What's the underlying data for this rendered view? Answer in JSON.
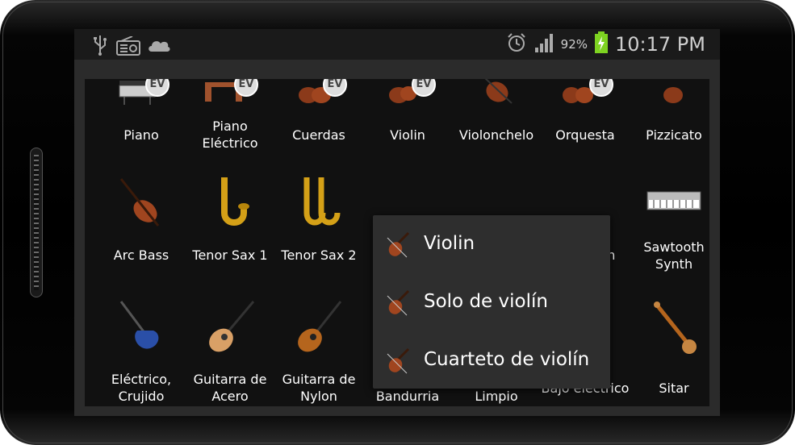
{
  "statusbar": {
    "left_icons": [
      "usb-icon",
      "radio-icon",
      "cloud-icon"
    ],
    "battery_percent": "92%",
    "time": "10:17 PM"
  },
  "instruments": {
    "row1": [
      "Piano",
      "Piano Eléctrico",
      "Cuerdas",
      "Violin",
      "Violonchelo",
      "Orquesta",
      "Pizzicato"
    ],
    "row2": [
      "Arc Bass",
      "Tenor Sax 1",
      "Tenor Sax 2",
      "",
      "",
      "th",
      "Sawtooth Synth"
    ],
    "row3": [
      "Eléctrico, Crujido",
      "Guitarra de Acero",
      "Guitarra de Nylon",
      "Mandolin, Bandurria",
      "Eléctrico, Limpio",
      "Bajo eléctrico",
      "Sitar"
    ]
  },
  "popup_menu": {
    "items": [
      "Violin",
      "Solo de violín",
      "Cuarteto de violín"
    ]
  },
  "ev_badge": "EV",
  "colors": {
    "screen_bg": "#111111",
    "popup_bg": "#2e2e2e",
    "battery": "#7ed321"
  }
}
